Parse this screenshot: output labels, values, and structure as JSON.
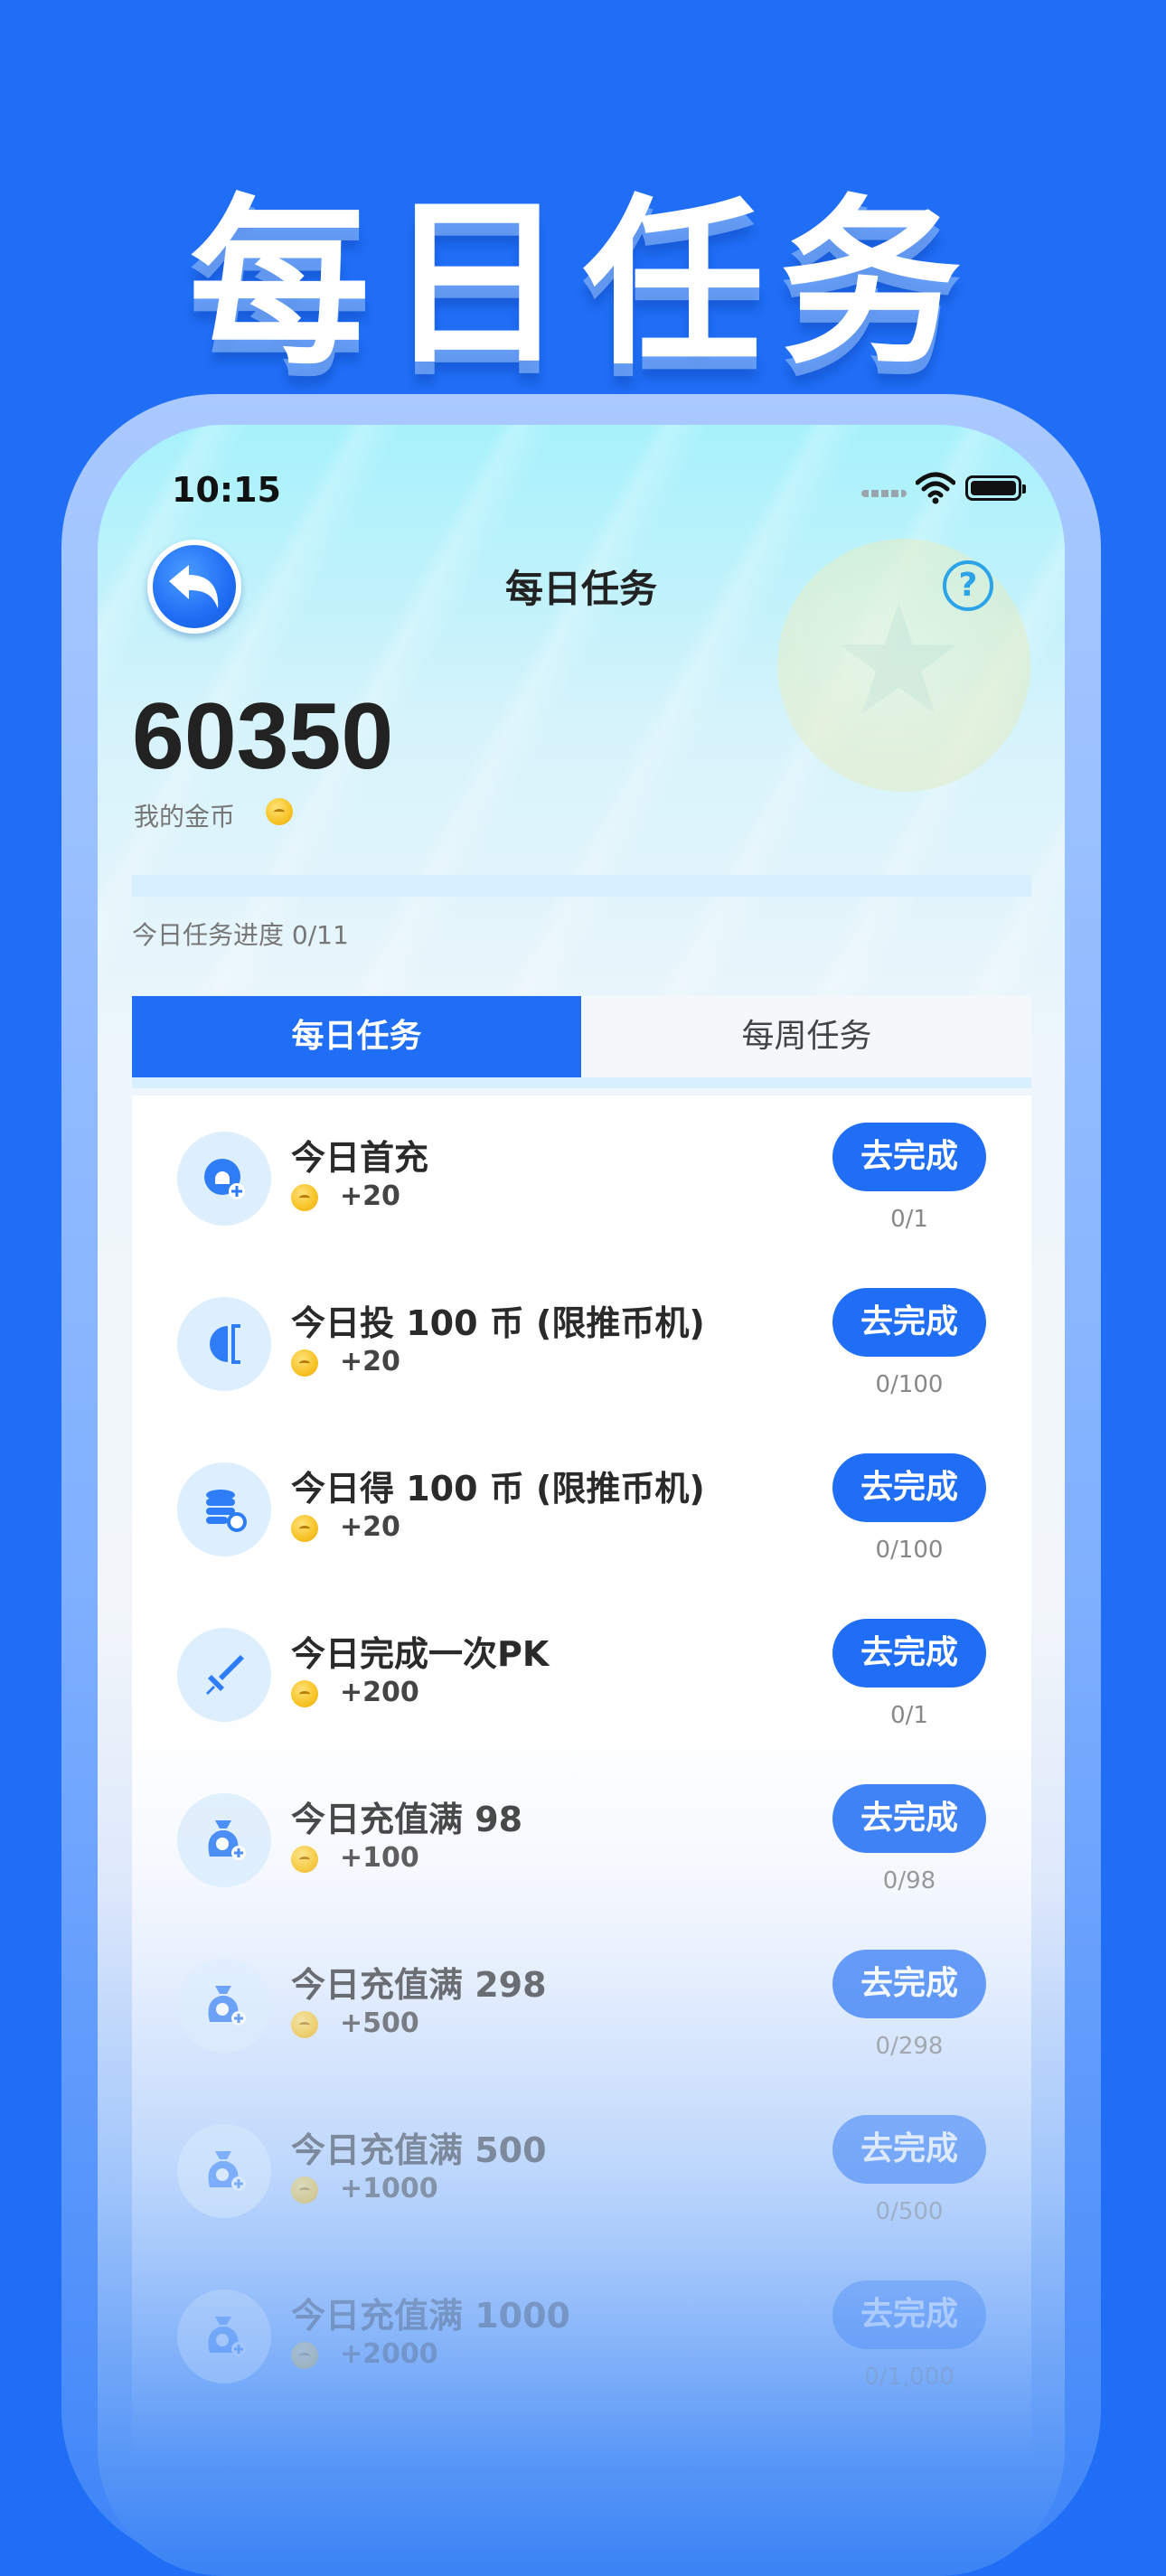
{
  "banner": {
    "title": "每日任务"
  },
  "status_bar": {
    "time": "10:15",
    "icons": [
      "signal-icon",
      "wifi-icon",
      "battery-icon"
    ]
  },
  "nav": {
    "back_icon": "back-arrow-icon",
    "title": "每日任务",
    "help_label": "?"
  },
  "wallet": {
    "amount": "60350",
    "label": "我的金币"
  },
  "progress": {
    "text": "今日任务进度 0/11",
    "done": 0,
    "total": 11
  },
  "tabs": [
    {
      "label": "每日任务",
      "active": true
    },
    {
      "label": "每周任务",
      "active": false
    }
  ],
  "colors": {
    "primary": "#1f6ef5",
    "track": "#d7efff",
    "icon_bg": "#ddeefd",
    "coin": "#f7c325"
  },
  "tasks": [
    {
      "icon": "recharge-icon",
      "title": "今日首充",
      "reward": "+20",
      "button": "去完成",
      "count": "0/1"
    },
    {
      "icon": "coin-insert-icon",
      "title": "今日投 100 币 (限推币机)",
      "reward": "+20",
      "button": "去完成",
      "count": "0/100"
    },
    {
      "icon": "coin-stack-icon",
      "title": "今日得 100 币 (限推币机)",
      "reward": "+20",
      "button": "去完成",
      "count": "0/100"
    },
    {
      "icon": "sword-icon",
      "title": "今日完成一次PK",
      "reward": "+200",
      "button": "去完成",
      "count": "0/1"
    },
    {
      "icon": "money-bag-icon",
      "title": "今日充值满 98",
      "reward": "+100",
      "button": "去完成",
      "count": "0/98"
    },
    {
      "icon": "money-bag-icon",
      "title": "今日充值满 298",
      "reward": "+500",
      "button": "去完成",
      "count": "0/298"
    },
    {
      "icon": "money-bag-icon",
      "title": "今日充值满 500",
      "reward": "+1000",
      "button": "去完成",
      "count": "0/500"
    },
    {
      "icon": "money-bag-icon",
      "title": "今日充值满 1000",
      "reward": "+2000",
      "button": "去完成",
      "count": "0/1,000"
    }
  ]
}
